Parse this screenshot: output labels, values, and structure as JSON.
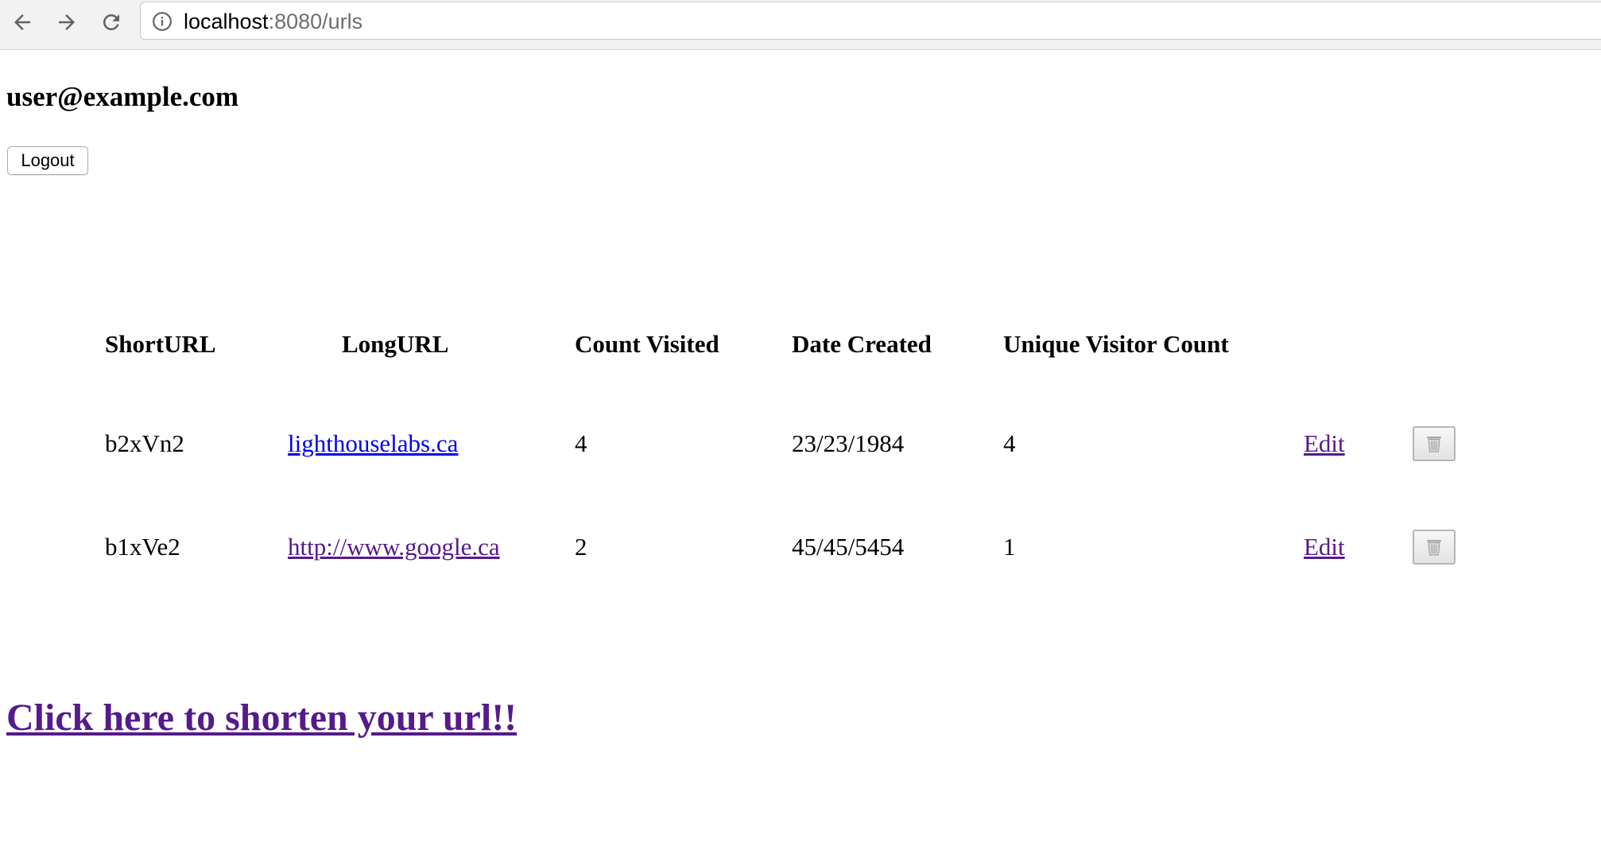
{
  "browser": {
    "url_host": "localhost",
    "url_rest": ":8080/urls"
  },
  "user": {
    "email": "user@example.com",
    "logout_label": "Logout"
  },
  "table": {
    "headers": [
      "ShortURL",
      "LongURL",
      "Count Visited",
      "Date Created",
      "Unique Visitor Count"
    ],
    "rows": [
      {
        "short": "b2xVn2",
        "long": "lighthouselabs.ca",
        "count": "4",
        "date": "23/23/1984",
        "unique": "4",
        "edit_label": "Edit"
      },
      {
        "short": "b1xVe2",
        "long": "http://www.google.ca",
        "count": "2",
        "date": "45/45/5454",
        "unique": "1",
        "edit_label": "Edit"
      }
    ]
  },
  "shorten_link_label": "Click here to shorten your url!!",
  "colors": {
    "link_unvisited": "#0000ee",
    "link_visited": "#551a8b"
  },
  "icons": [
    "back-arrow-icon",
    "forward-arrow-icon",
    "reload-icon",
    "info-icon",
    "trash-icon"
  ]
}
